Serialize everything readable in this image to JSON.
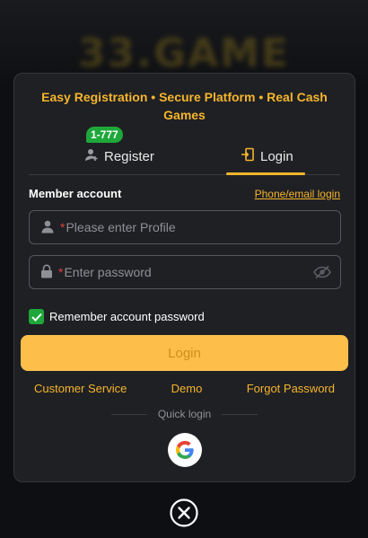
{
  "background": {
    "logo_text": "33.GAME"
  },
  "modal": {
    "promo": "Easy Registration • Secure Platform • Real Cash Games",
    "tabs": {
      "register_label": "Register",
      "register_badge": "1-777",
      "login_label": "Login",
      "active": "Login"
    },
    "member_label": "Member account",
    "phone_email_link": "Phone/email login",
    "profile_field": {
      "required_mark": "*",
      "placeholder": "Please enter Profile",
      "value": ""
    },
    "password_field": {
      "required_mark": "*",
      "placeholder": "Enter password",
      "value": ""
    },
    "remember": {
      "label": "Remember account password",
      "checked": true
    },
    "login_button": "Login",
    "links": {
      "customer_service": "Customer Service",
      "demo": "Demo",
      "forgot": "Forgot Password"
    },
    "quick_login": "Quick login",
    "icons": [
      "user-add-icon",
      "login-icon",
      "user-icon",
      "lock-icon",
      "eye-off-icon",
      "check-icon",
      "google-icon",
      "close-icon"
    ]
  },
  "colors": {
    "accent": "#f5b52c",
    "button": "#fdbf4a",
    "badge": "#1ea83a",
    "panel": "#1f2024",
    "required": "#e0413a"
  }
}
